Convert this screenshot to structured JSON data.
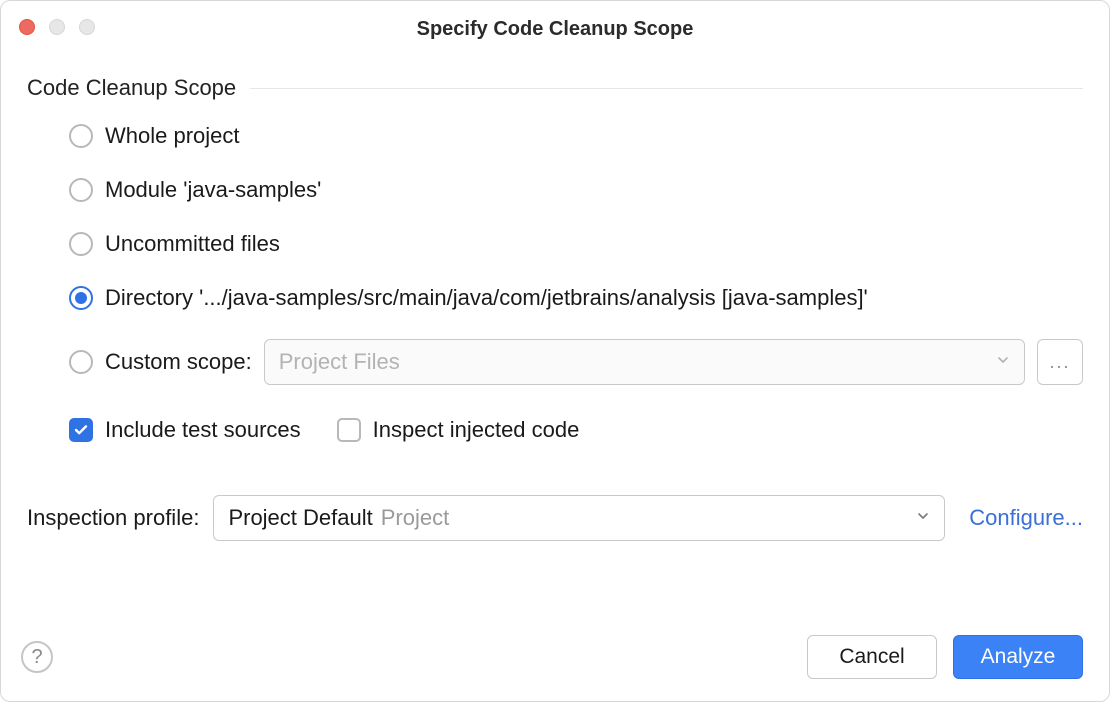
{
  "window": {
    "title": "Specify Code Cleanup Scope"
  },
  "group": {
    "title": "Code Cleanup Scope"
  },
  "options": {
    "whole_project": "Whole project",
    "module": "Module 'java-samples'",
    "uncommitted": "Uncommitted files",
    "directory": "Directory '.../java-samples/src/main/java/com/jetbrains/analysis [java-samples]'",
    "custom_scope_label": "Custom scope:",
    "custom_scope_value": "Project Files",
    "ellipsis": "..."
  },
  "checks": {
    "include_test_sources": "Include test sources",
    "inspect_injected": "Inspect injected code"
  },
  "profile": {
    "label": "Inspection profile:",
    "value_main": "Project Default",
    "value_secondary": "Project",
    "configure": "Configure..."
  },
  "footer": {
    "help": "?",
    "cancel": "Cancel",
    "analyze": "Analyze"
  }
}
